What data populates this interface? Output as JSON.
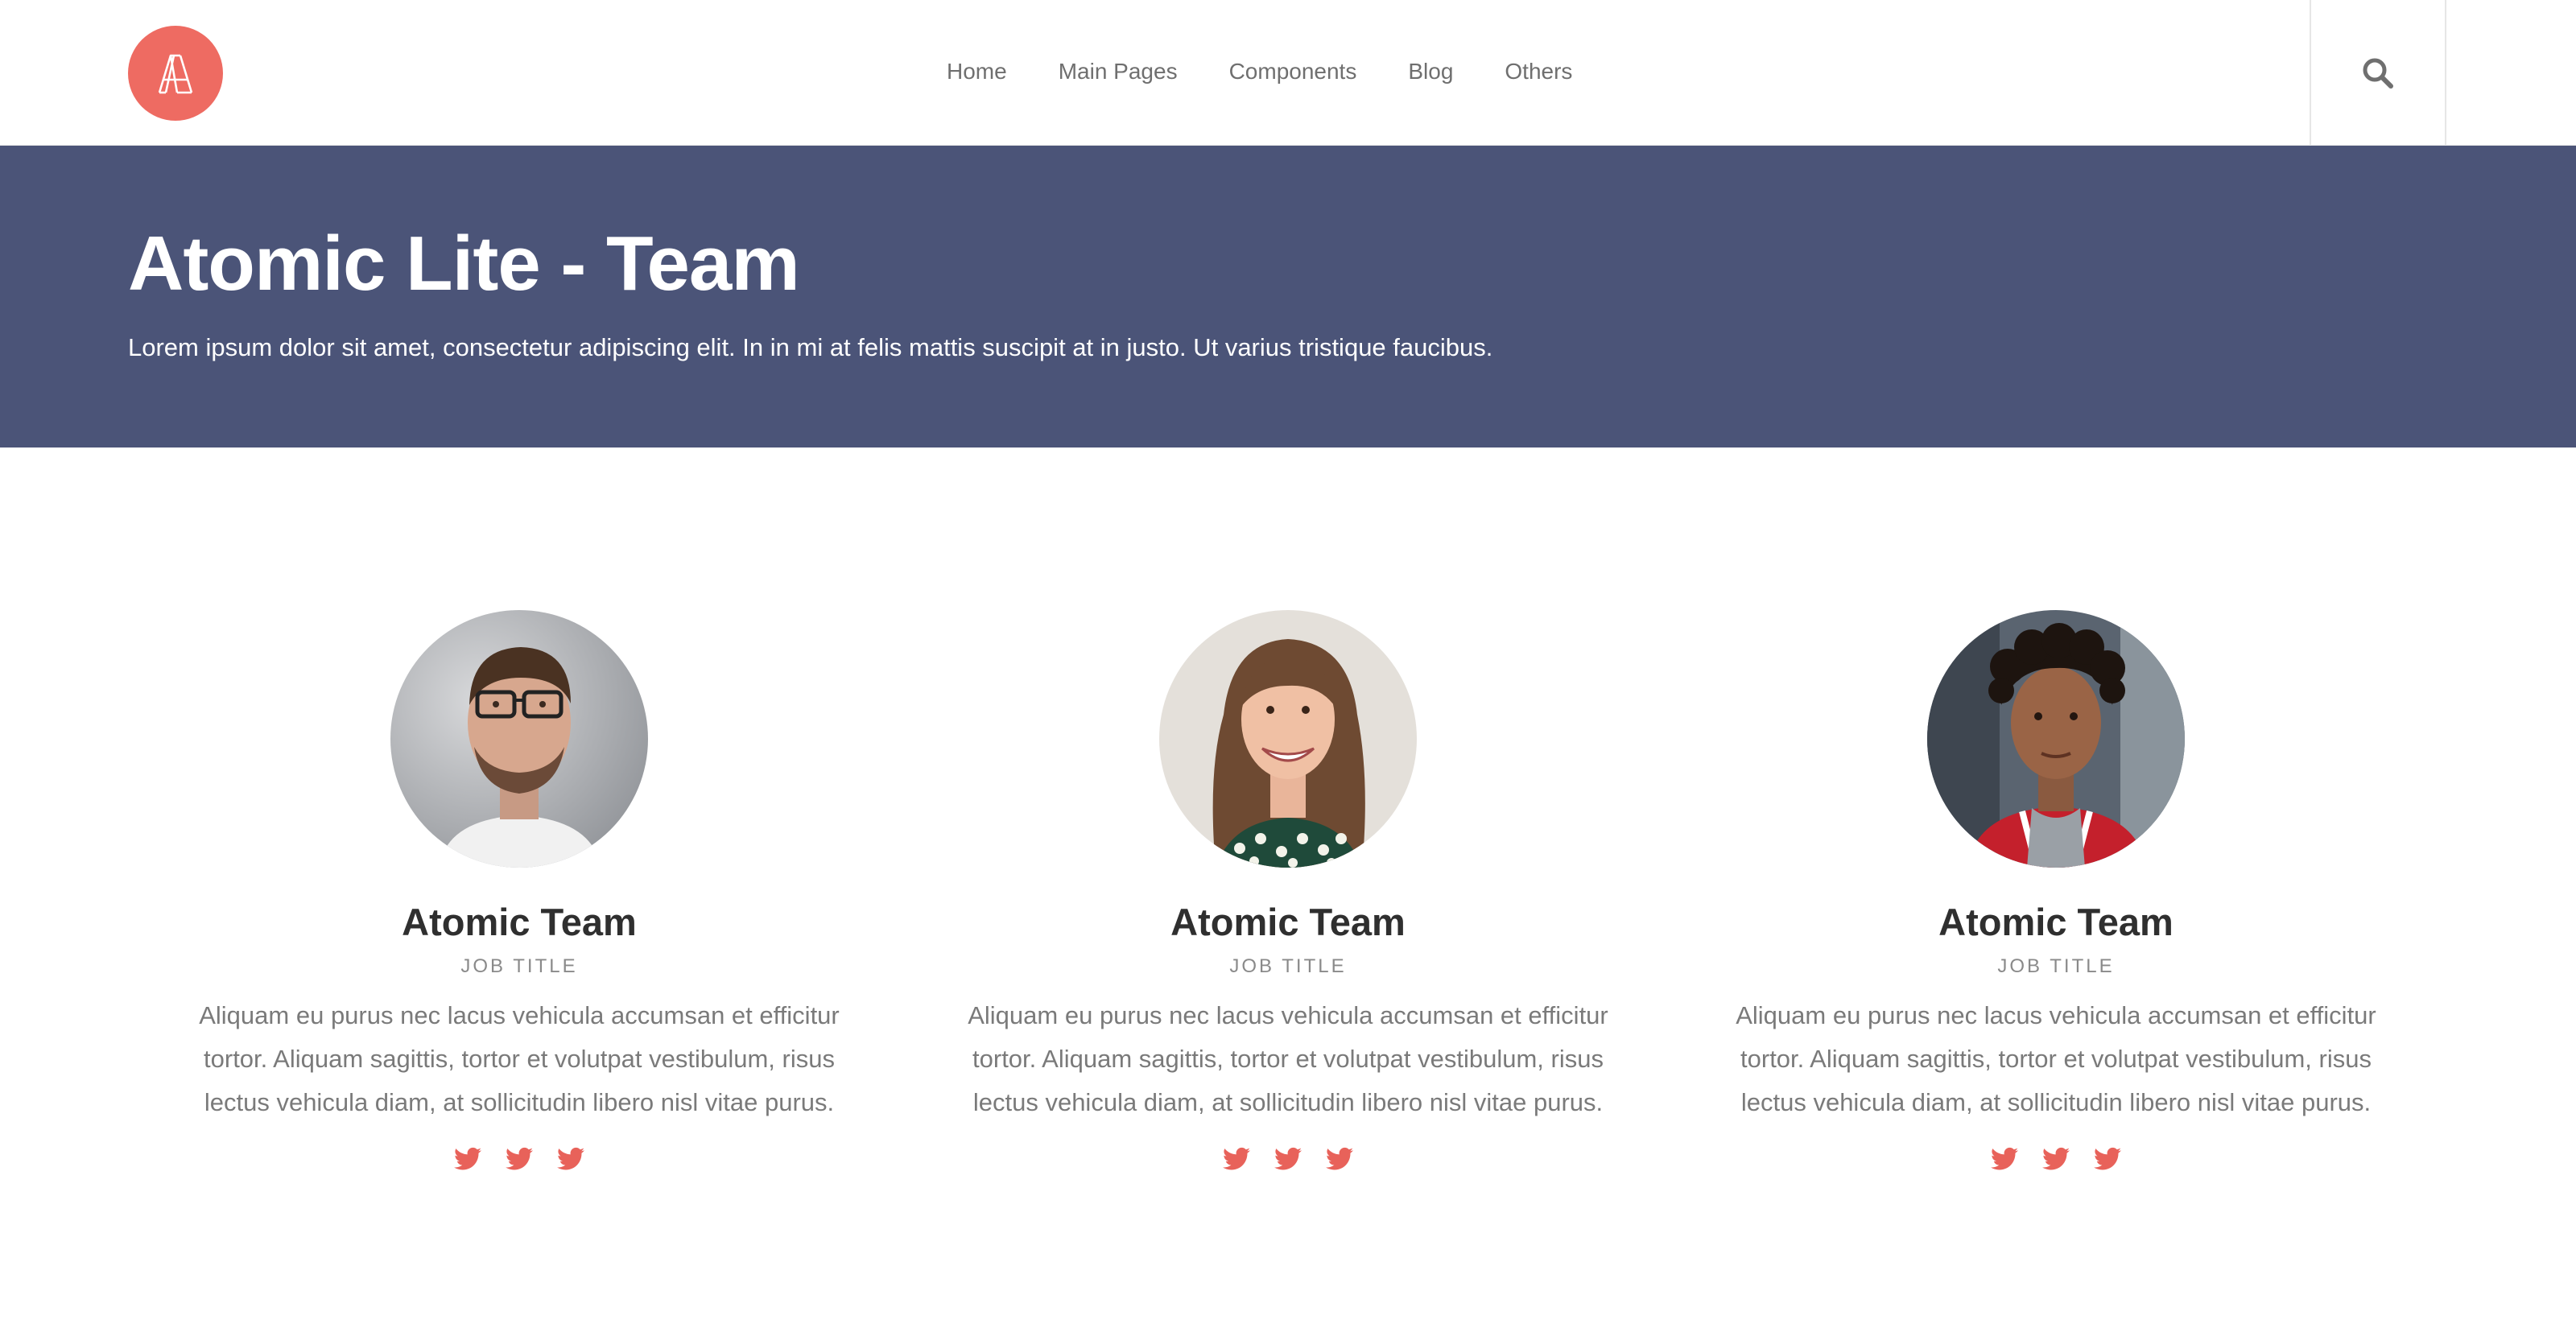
{
  "brand": {
    "logo_color": "#ee6b62",
    "logo_icon": "atomic-a-logo"
  },
  "nav": {
    "items": [
      {
        "label": "Home"
      },
      {
        "label": "Main Pages"
      },
      {
        "label": "Components"
      },
      {
        "label": "Blog"
      },
      {
        "label": "Others"
      }
    ],
    "search_icon": "search-icon"
  },
  "hero": {
    "title": "Atomic Lite - Team",
    "subtitle": "Lorem ipsum dolor sit amet, consectetur adipiscing elit. In in mi at felis mattis suscipit at in justo. Ut varius tristique faucibus.",
    "background": "#4b5478"
  },
  "team": {
    "members": [
      {
        "name": "Atomic Team",
        "job_title": "JOB TITLE",
        "bio": "Aliquam eu purus nec lacus vehicula accumsan et efficitur tortor. Aliquam sagittis, tortor et volutpat vestibulum, risus lectus vehicula diam, at sollicitudin libero nisl vitae purus.",
        "photo": "man-with-glasses-photo",
        "social_icons": [
          "twitter-icon",
          "twitter-icon",
          "twitter-icon"
        ]
      },
      {
        "name": "Atomic Team",
        "job_title": "JOB TITLE",
        "bio": "Aliquam eu purus nec lacus vehicula accumsan et efficitur tortor. Aliquam sagittis, tortor et volutpat vestibulum, risus lectus vehicula diam, at sollicitudin libero nisl vitae purus.",
        "photo": "smiling-woman-photo",
        "social_icons": [
          "twitter-icon",
          "twitter-icon",
          "twitter-icon"
        ]
      },
      {
        "name": "Atomic Team",
        "job_title": "JOB TITLE",
        "bio": "Aliquam eu purus nec lacus vehicula accumsan et efficitur tortor. Aliquam sagittis, tortor et volutpat vestibulum, risus lectus vehicula diam, at sollicitudin libero nisl vitae purus.",
        "photo": "young-man-red-jacket-photo",
        "social_icons": [
          "twitter-icon",
          "twitter-icon",
          "twitter-icon"
        ]
      }
    ],
    "social_color": "#e8625a"
  }
}
